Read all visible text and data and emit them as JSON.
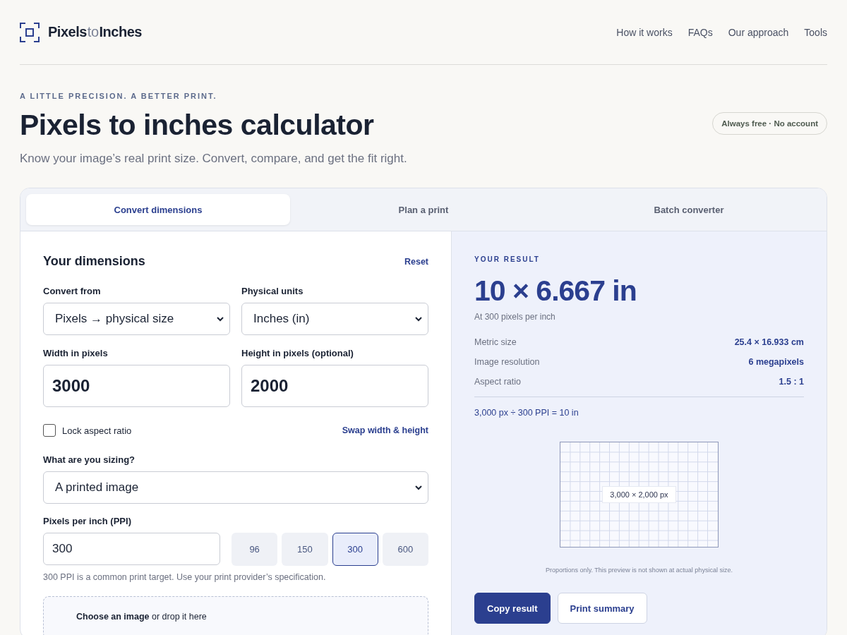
{
  "header": {
    "logo": {
      "part_1": "Pixels",
      "part_2": "to",
      "part_3": "Inches"
    },
    "nav": [
      "How it works",
      "FAQs",
      "Our approach",
      "Tools"
    ]
  },
  "hero": {
    "eyebrow": "A LITTLE PRECISION. A BETTER PRINT.",
    "title": "Pixels to inches calculator",
    "subtitle": "Know your image’s real print size. Convert, compare, and get the fit right.",
    "badge": "Always free · No account"
  },
  "tabs": [
    {
      "label": "Convert dimensions",
      "selected": true
    },
    {
      "label": "Plan a print",
      "selected": false
    },
    {
      "label": "Batch converter",
      "selected": false
    }
  ],
  "form": {
    "title": "Your dimensions",
    "reset": "Reset",
    "convert_from": {
      "label": "Convert from",
      "value": "Pixels → physical size"
    },
    "units": {
      "label": "Physical units",
      "value": "Inches (in)"
    },
    "width": {
      "label": "Width in pixels",
      "value": "3000"
    },
    "height": {
      "label": "Height in pixels (optional)",
      "value": "2000"
    },
    "lock": {
      "label": "Lock aspect ratio",
      "checked": false
    },
    "swap": "Swap width & height",
    "sizing": {
      "label": "What are you sizing?",
      "value": "A printed image"
    },
    "ppi": {
      "label": "Pixels per inch (PPI)",
      "value": "300",
      "presets": [
        {
          "label": "96",
          "selected": false
        },
        {
          "label": "150",
          "selected": false
        },
        {
          "label": "300",
          "selected": true
        },
        {
          "label": "600",
          "selected": false
        }
      ],
      "hint": "300 PPI is a common print target. Use your print provider’s specification."
    },
    "dropzone": "**Choose an image** or drop it here"
  },
  "result": {
    "eyebrow": "YOUR RESULT",
    "value": "10 × 6.667 in",
    "caption": "At 300 pixels per inch",
    "rows": [
      {
        "label": "Metric size",
        "value": "25.4 × 16.933 cm"
      },
      {
        "label": "Image resolution",
        "value": "6 megapixels"
      },
      {
        "label": "Aspect ratio",
        "value": "1.5 : 1"
      }
    ],
    "formula": "3,000 px ÷ 300 PPI = 10 in",
    "preview_label": "3,000 × 2,000 px",
    "preview_note": "Proportions only. This preview is not shown at actual physical size.",
    "buttons": [
      {
        "label": "Copy result",
        "kind": "primary"
      },
      {
        "label": "Print summary",
        "kind": "secondary"
      }
    ]
  }
}
